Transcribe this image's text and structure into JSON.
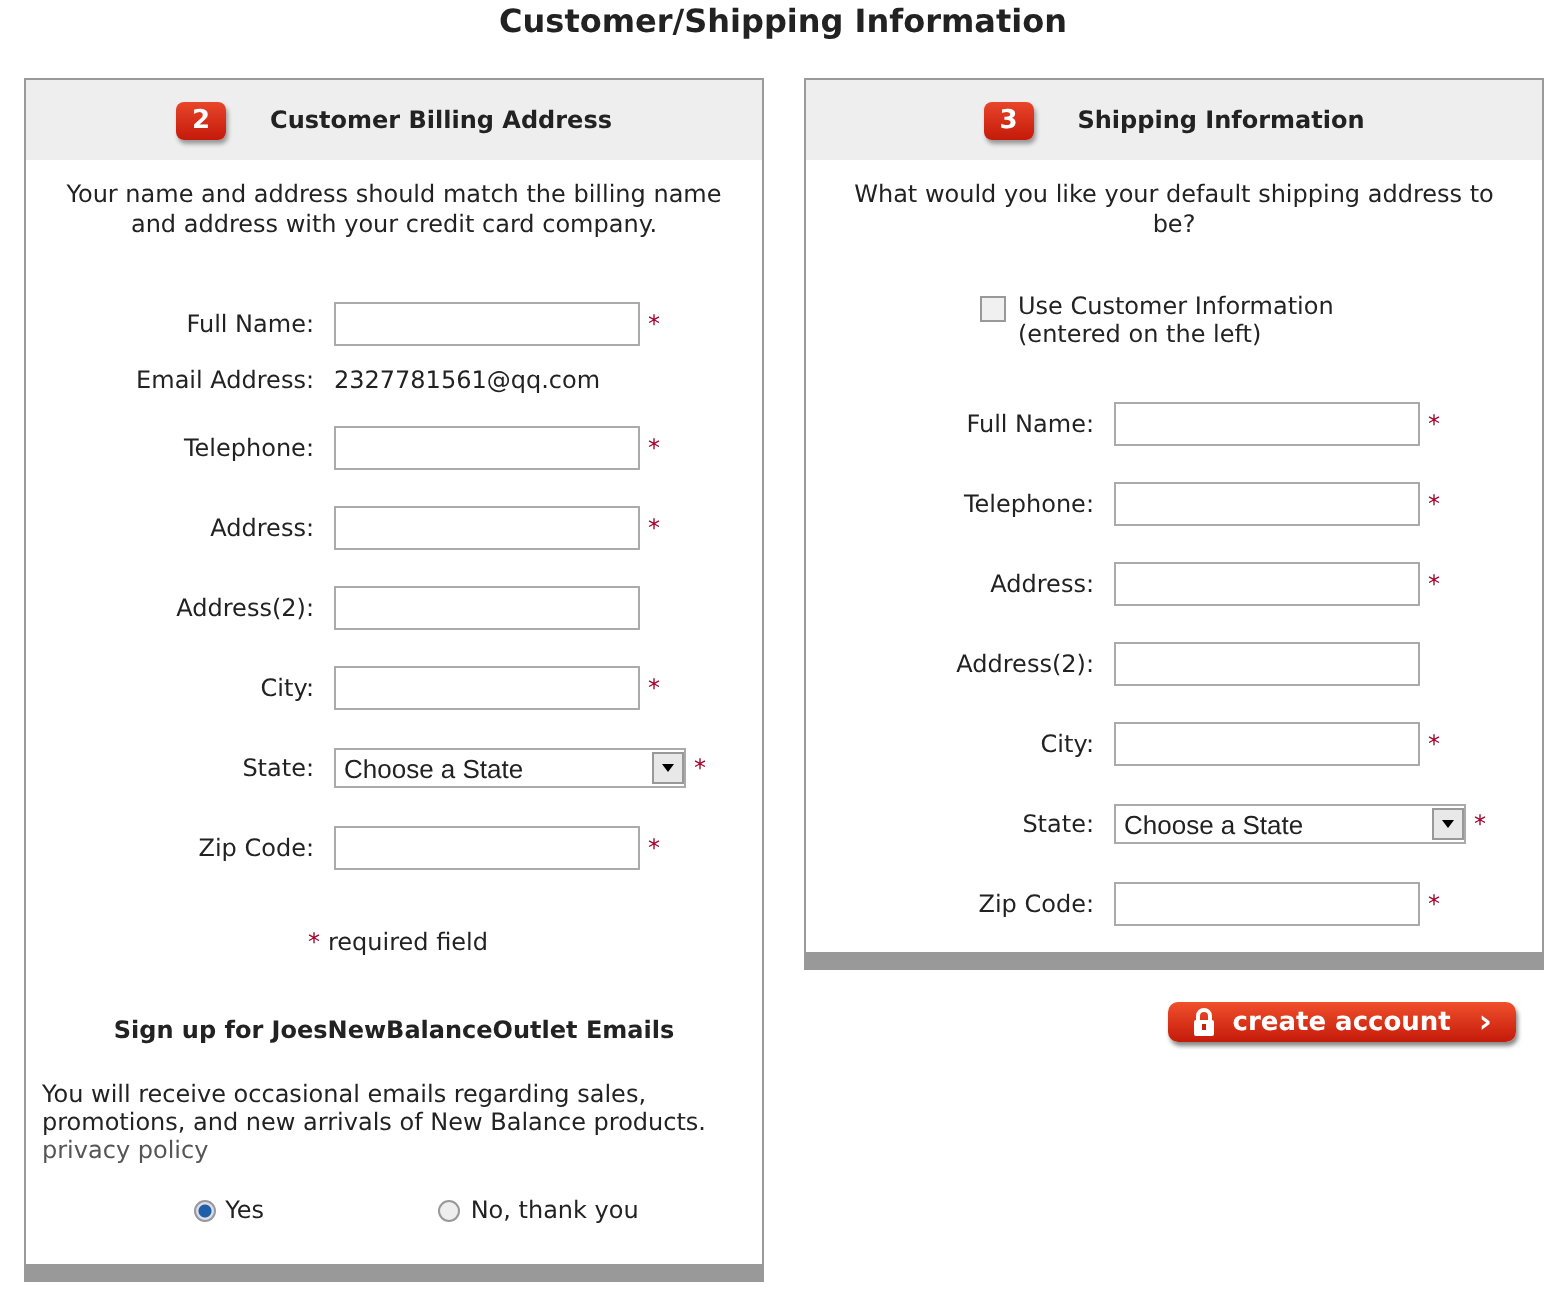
{
  "title": "Customer/Shipping Information",
  "billing": {
    "step": "2",
    "heading": "Customer Billing Address",
    "intro": "Your name and address should match the billing name and address with your credit card company.",
    "fields": [
      {
        "kind": "input",
        "label": "Full Name:",
        "required": true
      },
      {
        "kind": "text",
        "label": "Email Address:",
        "value": "2327781561@qq.com",
        "required": false
      },
      {
        "kind": "input",
        "label": "Telephone:",
        "required": true
      },
      {
        "kind": "input",
        "label": "Address:",
        "required": true
      },
      {
        "kind": "input",
        "label": "Address(2):",
        "required": false
      },
      {
        "kind": "input",
        "label": "City:",
        "required": true
      },
      {
        "kind": "select",
        "label": "State:",
        "value": "Choose a State",
        "required": true
      },
      {
        "kind": "input",
        "label": "Zip Code:",
        "required": true
      }
    ],
    "required_mark": "*",
    "required_note": "required field",
    "signup_heading": "Sign up for JoesNewBalanceOutlet Emails",
    "signup_text": "You will receive occasional emails regarding sales, promotions, and new arrivals of New Balance products.",
    "privacy_link": "privacy policy",
    "options": [
      {
        "label": "Yes",
        "selected": true
      },
      {
        "label": "No, thank you",
        "selected": false
      }
    ]
  },
  "shipping": {
    "step": "3",
    "heading": "Shipping Information",
    "intro": "What would you like your default shipping address to be?",
    "use_customer": {
      "label": "Use Customer Information (entered on the left)",
      "checked": false
    },
    "fields": [
      {
        "kind": "input",
        "label": "Full Name:",
        "required": true
      },
      {
        "kind": "input",
        "label": "Telephone:",
        "required": true
      },
      {
        "kind": "input",
        "label": "Address:",
        "required": true
      },
      {
        "kind": "input",
        "label": "Address(2):",
        "required": false
      },
      {
        "kind": "input",
        "label": "City:",
        "required": true
      },
      {
        "kind": "select",
        "label": "State:",
        "value": "Choose a State",
        "required": true
      },
      {
        "kind": "input",
        "label": "Zip Code:",
        "required": true
      }
    ]
  },
  "create_button": {
    "label": "create account",
    "arrow": "›"
  }
}
